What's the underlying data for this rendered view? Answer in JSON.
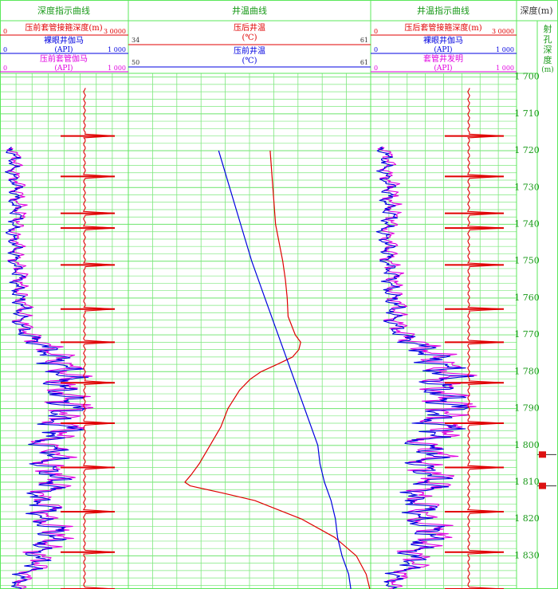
{
  "chart_data": {
    "type": "line",
    "title": "",
    "columns": {
      "depth_indicator_left": {
        "title": "深度指示曲线",
        "curves": [
          {
            "name": "压前套管接箍深度(m)",
            "min": "0",
            "max": "3 0000",
            "color": "#e00000"
          },
          {
            "name": "裸眼井伽马",
            "unit": "(API)",
            "min": "0",
            "max": "1 000",
            "color": "#0000e0"
          },
          {
            "name": "压前套管伽马",
            "unit": "(API)",
            "min": "0",
            "max": "1 000",
            "color": "#e000e0"
          }
        ]
      },
      "temperature": {
        "title": "井温曲线",
        "curves": [
          {
            "name": "压后井温",
            "unit": "(℃)",
            "min": "34",
            "max": "61",
            "color": "#e00000"
          },
          {
            "name": "压前井温",
            "unit": "(℃)",
            "min": "50",
            "max": "61",
            "color": "#0000e0"
          }
        ]
      },
      "depth_indicator_right": {
        "title": "井温指示曲线",
        "curves": [
          {
            "name": "压后套管接箍深度(m)",
            "min": "0",
            "max": "3 0000",
            "color": "#e00000"
          },
          {
            "name": "裸眼井伽马",
            "unit": "(API)",
            "min": "0",
            "max": "1 000",
            "color": "#0000e0"
          },
          {
            "name": "套管井发明",
            "unit": "(API)",
            "min": "0",
            "max": "1 000",
            "color": "#e000e0"
          }
        ]
      },
      "depth": {
        "title": "深度(m)",
        "ticks": [
          "1 700",
          "1 710",
          "1 720",
          "1 730",
          "1 740",
          "1 750",
          "1 760",
          "1 770",
          "1 780",
          "1 790",
          "1 800",
          "1 810",
          "1 820",
          "1 830"
        ]
      },
      "perforation": {
        "title_chars": [
          "射",
          "孔",
          "深",
          "度",
          "(m)"
        ]
      }
    },
    "depth_range": [
      1699,
      1839
    ],
    "perforation_intervals": [
      1802.5,
      1811.0
    ],
    "post_frac_temperature": {
      "depth": [
        1720,
        1730,
        1740,
        1745,
        1750,
        1755,
        1760,
        1765,
        1770,
        1772,
        1774,
        1776,
        1778,
        1780,
        1782,
        1785,
        1790,
        1795,
        1800,
        1805,
        1808,
        1810,
        1811,
        1813,
        1815,
        1820,
        1825,
        1830,
        1835,
        1839
      ],
      "value": [
        49.8,
        50.1,
        50.4,
        50.8,
        51.2,
        51.5,
        51.7,
        51.8,
        52.6,
        53.2,
        53.0,
        52.3,
        50.6,
        48.8,
        47.6,
        46.4,
        45.1,
        44.3,
        43.1,
        41.9,
        41.0,
        40.3,
        40.9,
        44.6,
        48.1,
        53.3,
        57.0,
        59.4,
        60.5,
        60.9
      ]
    },
    "pre_frac_temperature": {
      "depth": [
        1720,
        1730,
        1740,
        1750,
        1760,
        1770,
        1780,
        1790,
        1800,
        1805,
        1810,
        1815,
        1820,
        1825,
        1830,
        1835,
        1839
      ],
      "value": [
        54.1,
        54.6,
        55.1,
        55.6,
        56.2,
        56.8,
        57.4,
        58.0,
        58.6,
        58.7,
        58.9,
        59.2,
        59.4,
        59.5,
        59.7,
        60.0,
        60.1
      ]
    },
    "collar_depth_pre": [
      1716,
      1727,
      1737,
      1741,
      1751,
      1763,
      1772,
      1783,
      1794,
      1806,
      1818,
      1829,
      1839
    ],
    "collar_depth_post": [
      1716,
      1727,
      1737,
      1741,
      1751,
      1763,
      1772,
      1783,
      1794,
      1806,
      1818,
      1829,
      1839
    ],
    "openhole_gamma_profile": {
      "depth": [
        1719,
        1722,
        1726,
        1730,
        1734,
        1738,
        1742,
        1746,
        1750,
        1754,
        1758,
        1762,
        1766,
        1770,
        1772,
        1775,
        1778,
        1781,
        1784,
        1787,
        1790,
        1793,
        1796,
        1799,
        1802,
        1805,
        1808,
        1811,
        1814,
        1817,
        1820,
        1823,
        1826,
        1829,
        1832,
        1835,
        1839
      ],
      "value": [
        70,
        110,
        90,
        130,
        110,
        140,
        80,
        120,
        110,
        150,
        130,
        170,
        150,
        200,
        300,
        400,
        470,
        520,
        450,
        500,
        560,
        400,
        540,
        300,
        450,
        330,
        420,
        420,
        270,
        380,
        300,
        430,
        380,
        280,
        300,
        180,
        120
      ]
    },
    "cased_gamma_profile": {
      "depth": [
        1719,
        1722,
        1726,
        1730,
        1734,
        1738,
        1742,
        1746,
        1750,
        1754,
        1758,
        1762,
        1766,
        1770,
        1772,
        1775,
        1778,
        1781,
        1784,
        1787,
        1790,
        1793,
        1796,
        1799,
        1802,
        1805,
        1808,
        1811,
        1814,
        1817,
        1820,
        1823,
        1826,
        1829,
        1832,
        1835,
        1839
      ],
      "value": [
        90,
        130,
        110,
        150,
        140,
        160,
        110,
        140,
        130,
        170,
        150,
        190,
        170,
        230,
        330,
        430,
        500,
        540,
        470,
        520,
        600,
        430,
        570,
        320,
        480,
        360,
        450,
        440,
        300,
        400,
        330,
        470,
        410,
        300,
        330,
        210,
        140
      ]
    }
  }
}
